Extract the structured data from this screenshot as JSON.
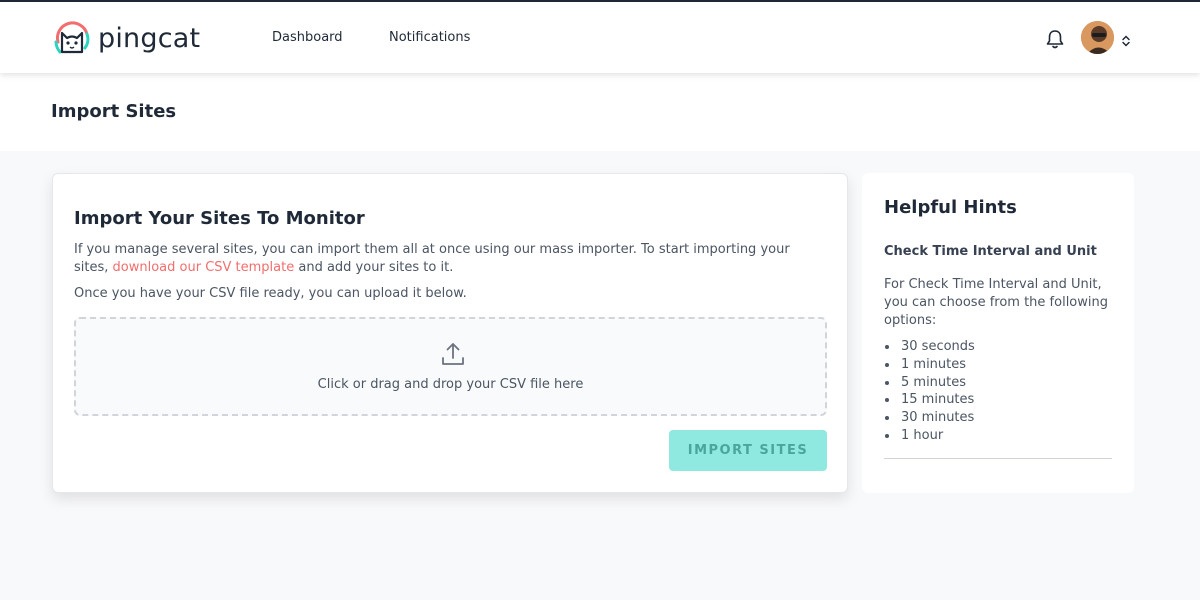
{
  "brand": {
    "name": "pingcat"
  },
  "nav": {
    "links": [
      {
        "label": "Dashboard"
      },
      {
        "label": "Notifications"
      }
    ],
    "icons": {
      "bell": "bell-icon",
      "caret": "chevron-up-down-icon"
    }
  },
  "page": {
    "title": "Import Sites"
  },
  "import_card": {
    "title": "Import Your Sites To Monitor",
    "intro_before_link": "If you manage several sites, you can import them all at once using our mass importer. To start importing your sites, ",
    "csv_link": "download our CSV template",
    "intro_after_link": " and add your sites to it.",
    "ready_text": "Once you have your CSV file ready, you can upload it below.",
    "dropzone_text": "Click or drag and drop your CSV file here",
    "import_button": "IMPORT SITES"
  },
  "hints": {
    "title": "Helpful Hints",
    "subtitle": "Check Time Interval and Unit",
    "text": "For Check Time Interval and Unit, you can choose from the following options:",
    "options": [
      "30 seconds",
      "1 minutes",
      "5 minutes",
      "15 minutes",
      "30 minutes",
      "1 hour"
    ]
  },
  "colors": {
    "link": "#f26d6d",
    "button_bg": "#8fe9e1",
    "button_text": "#4aa69d",
    "text_dark": "#1f2937"
  }
}
